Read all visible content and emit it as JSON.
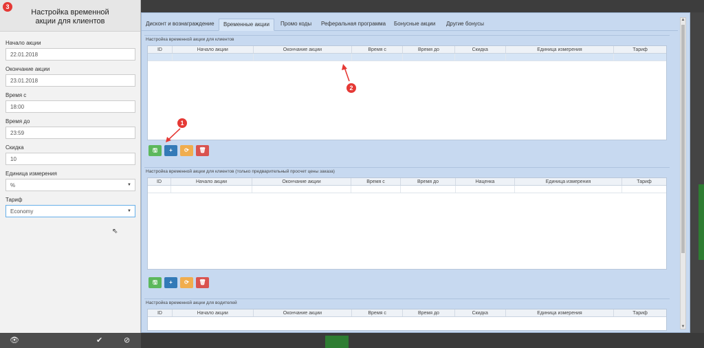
{
  "left_panel": {
    "title": "Настройка временной акции для клиентов",
    "badge": "3",
    "fields": [
      {
        "label": "Начало акции",
        "value": "22.01.2018"
      },
      {
        "label": "Окончание акции",
        "value": "23.01.2018"
      },
      {
        "label": "Время с",
        "value": "18:00"
      },
      {
        "label": "Время до",
        "value": "23:59"
      },
      {
        "label": "Скидка",
        "value": "10"
      },
      {
        "label": "Единица измерения",
        "value": "%"
      },
      {
        "label": "Тариф",
        "value": "Economy"
      }
    ],
    "footer_icons": [
      "eye-icon",
      "check-icon",
      "cancel-icon"
    ]
  },
  "tabs": [
    "Дисконт и вознаграждение",
    "Временные акции",
    "Промо коды",
    "Реферальная программа",
    "Бонусные акции",
    "Другие бонусы"
  ],
  "active_tab": "Временные акции",
  "sections": [
    {
      "title": "Настройка временной акции для клиентов",
      "columns": [
        "ID",
        "Начало акции",
        "Окончание акции",
        "Время с",
        "Время до",
        "Скидка",
        "Единица измерения",
        "Тариф"
      ]
    },
    {
      "title": "Настройка временной акции для клиентов (только предварительный просчет цены заказа)",
      "columns": [
        "ID",
        "Начало акции",
        "Окончание акции",
        "Время с",
        "Время до",
        "Наценка",
        "Единица измерения",
        "Тариф"
      ]
    },
    {
      "title": "Настройка временной акции для водителей",
      "columns": [
        "ID",
        "Начало акции",
        "Окончание акции",
        "Время с",
        "Время до",
        "Скидка",
        "Единица измерения",
        "Тариф"
      ]
    }
  ],
  "buttons": {
    "save": "🖫",
    "add": "+",
    "refresh": "⟳",
    "delete": "🗑"
  },
  "annotations": {
    "one": "1",
    "two": "2"
  },
  "colors": {
    "accent": "#e53935",
    "dialog_bg": "#c7d9f0",
    "save": "#5cb85c",
    "add": "#337ab7",
    "refresh": "#f0ad4e",
    "delete": "#d9534f"
  }
}
